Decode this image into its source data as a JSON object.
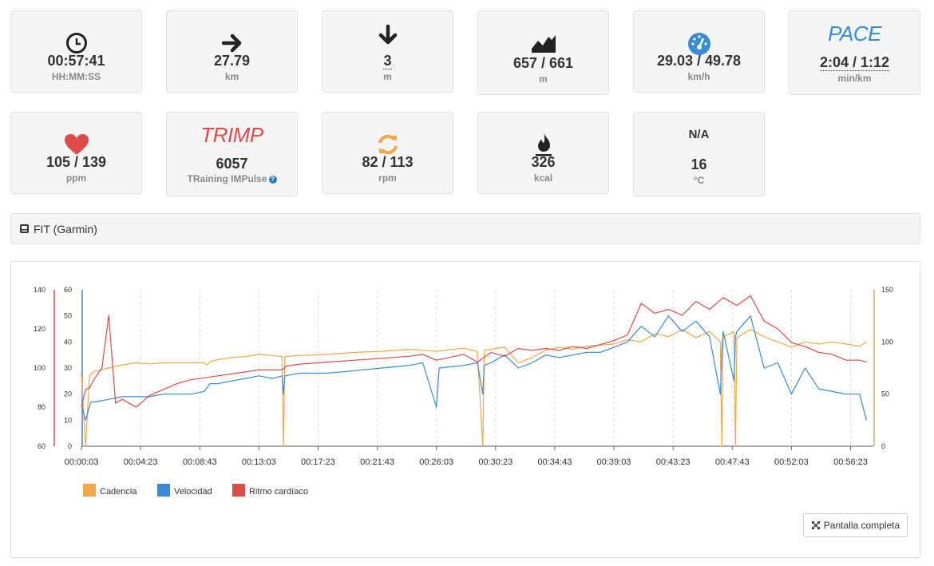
{
  "stats": {
    "time": {
      "value": "00:57:41",
      "unit": "HH:MM:SS"
    },
    "distance": {
      "value": "27.79",
      "unit": "km"
    },
    "descent": {
      "value": "3",
      "unit": "m"
    },
    "elevation": {
      "value": "657 / 661",
      "unit": "m"
    },
    "speed": {
      "value": "29.03 / 49.78",
      "unit": "km/h"
    },
    "pace": {
      "label": "PACE",
      "value": "2:04 / 1:12",
      "unit": "min/km"
    },
    "heart_rate": {
      "value": "105 / 139",
      "unit": "ppm"
    },
    "trimp": {
      "label": "TRIMP",
      "value": "6057",
      "unit": "TRaining IMPulse"
    },
    "cadence": {
      "value": "82 / 113",
      "unit": "rpm"
    },
    "calories": {
      "value": "326",
      "unit": "kcal"
    },
    "temperature": {
      "status": "N/A",
      "value": "16",
      "unit": "°C"
    }
  },
  "source": {
    "label": "FIT (Garmin)"
  },
  "fullscreen_label": "Pantalla completa",
  "colors": {
    "cadence": "#f0a848",
    "speed": "#3a8ad4",
    "heart_rate": "#df4b4b",
    "pace": "#3a8ad4",
    "trimp": "#df4b4b",
    "refresh": "#f0a848"
  },
  "chart_data": {
    "type": "line",
    "x_ticks": [
      "00:00:03",
      "00:04:23",
      "00:08:43",
      "00:13:03",
      "00:17:23",
      "00:21:43",
      "00:26:03",
      "00:30:23",
      "00:34:43",
      "00:39:03",
      "00:43:23",
      "00:47:43",
      "00:52:03",
      "00:56:23"
    ],
    "x_minutes": [
      0,
      58
    ],
    "legend": [
      "Cadencia",
      "Velocidad",
      "Ritmo cardíaco"
    ],
    "axes": {
      "heart_rate": {
        "ticks": [
          60,
          80,
          100,
          120,
          140
        ],
        "range": [
          60,
          140
        ]
      },
      "speed": {
        "ticks": [
          0,
          10,
          20,
          30,
          40,
          50,
          60
        ],
        "range": [
          0,
          60
        ]
      },
      "cadence": {
        "ticks": [
          0,
          50,
          100,
          150
        ],
        "range": [
          0,
          150
        ]
      }
    },
    "series": [
      {
        "name": "Cadencia",
        "axis": "cadence",
        "color": "#f0a848",
        "points": [
          [
            0,
            70
          ],
          [
            0.3,
            0
          ],
          [
            0.6,
            68
          ],
          [
            1,
            72
          ],
          [
            2,
            75
          ],
          [
            3,
            78
          ],
          [
            4,
            80
          ],
          [
            5,
            79
          ],
          [
            6,
            80
          ],
          [
            8,
            80
          ],
          [
            9,
            80
          ],
          [
            9.2,
            78
          ],
          [
            9.4,
            81
          ],
          [
            10,
            83
          ],
          [
            11,
            85
          ],
          [
            12,
            86
          ],
          [
            13,
            88
          ],
          [
            14,
            87
          ],
          [
            14.7,
            86
          ],
          [
            14.8,
            0
          ],
          [
            14.9,
            86
          ],
          [
            16,
            87
          ],
          [
            18,
            88
          ],
          [
            20,
            90
          ],
          [
            22,
            91
          ],
          [
            24,
            93
          ],
          [
            25,
            92
          ],
          [
            26,
            91
          ],
          [
            28,
            94
          ],
          [
            29,
            91
          ],
          [
            29.4,
            0
          ],
          [
            29.5,
            92
          ],
          [
            30,
            93
          ],
          [
            31,
            95
          ],
          [
            32,
            80
          ],
          [
            33,
            85
          ],
          [
            34,
            92
          ],
          [
            35,
            95
          ],
          [
            36,
            93
          ],
          [
            37,
            96
          ],
          [
            38,
            97
          ],
          [
            39,
            98
          ],
          [
            40,
            102
          ],
          [
            41,
            100
          ],
          [
            42,
            108
          ],
          [
            43,
            105
          ],
          [
            44,
            112
          ],
          [
            45,
            104
          ],
          [
            46,
            110
          ],
          [
            46.8,
            100
          ],
          [
            46.9,
            0
          ],
          [
            47,
            105
          ],
          [
            47.8,
            110
          ],
          [
            47.9,
            0
          ],
          [
            48,
            104
          ],
          [
            49,
            112
          ],
          [
            50,
            105
          ],
          [
            51,
            100
          ],
          [
            52,
            95
          ],
          [
            53,
            100
          ],
          [
            54,
            98
          ],
          [
            55,
            100
          ],
          [
            56,
            98
          ],
          [
            57,
            96
          ],
          [
            57.5,
            100
          ]
        ]
      },
      {
        "name": "Velocidad",
        "axis": "speed",
        "color": "#3a8ad4",
        "points": [
          [
            0,
            16
          ],
          [
            0.3,
            10
          ],
          [
            0.7,
            17
          ],
          [
            1,
            17
          ],
          [
            2,
            18
          ],
          [
            3,
            19
          ],
          [
            4,
            19
          ],
          [
            5,
            19
          ],
          [
            6,
            20
          ],
          [
            7,
            20
          ],
          [
            8,
            20
          ],
          [
            9,
            21
          ],
          [
            9.4,
            24
          ],
          [
            10,
            24
          ],
          [
            11,
            25
          ],
          [
            12,
            26
          ],
          [
            13,
            27
          ],
          [
            14,
            26
          ],
          [
            14.7,
            27
          ],
          [
            14.8,
            20
          ],
          [
            14.9,
            27
          ],
          [
            16,
            28
          ],
          [
            18,
            28
          ],
          [
            20,
            29
          ],
          [
            22,
            30
          ],
          [
            24,
            31
          ],
          [
            25,
            32
          ],
          [
            26,
            15
          ],
          [
            26.2,
            30
          ],
          [
            28,
            31
          ],
          [
            29,
            32
          ],
          [
            29.4,
            20
          ],
          [
            29.5,
            31
          ],
          [
            30,
            32
          ],
          [
            31,
            35
          ],
          [
            32,
            30
          ],
          [
            33,
            32
          ],
          [
            34,
            35
          ],
          [
            35,
            34
          ],
          [
            36,
            35
          ],
          [
            37,
            36
          ],
          [
            38,
            36
          ],
          [
            39,
            38
          ],
          [
            40,
            40
          ],
          [
            41,
            46
          ],
          [
            42,
            42
          ],
          [
            43,
            50
          ],
          [
            44,
            44
          ],
          [
            45,
            48
          ],
          [
            46,
            42
          ],
          [
            46.8,
            20
          ],
          [
            46.9,
            36
          ],
          [
            47,
            44
          ],
          [
            47.8,
            25
          ],
          [
            47.9,
            42
          ],
          [
            48,
            44
          ],
          [
            49,
            50
          ],
          [
            50,
            30
          ],
          [
            51,
            32
          ],
          [
            52,
            20
          ],
          [
            53,
            30
          ],
          [
            54,
            22
          ],
          [
            55,
            21
          ],
          [
            56,
            20
          ],
          [
            57,
            20
          ],
          [
            57.5,
            10
          ]
        ]
      },
      {
        "name": "Ritmo cardíaco",
        "axis": "heart_rate",
        "color": "#df4b4b",
        "points": [
          [
            0,
            80
          ],
          [
            0.3,
            89
          ],
          [
            0.6,
            90
          ],
          [
            1,
            95
          ],
          [
            1.5,
            100
          ],
          [
            2,
            127
          ],
          [
            2.5,
            82
          ],
          [
            3,
            84
          ],
          [
            4,
            80
          ],
          [
            5,
            86
          ],
          [
            6,
            89
          ],
          [
            7,
            92
          ],
          [
            8,
            94
          ],
          [
            9,
            95
          ],
          [
            10,
            96
          ],
          [
            11,
            97
          ],
          [
            12,
            98
          ],
          [
            13,
            99
          ],
          [
            14,
            99
          ],
          [
            14.7,
            99
          ],
          [
            15,
            101
          ],
          [
            16,
            102
          ],
          [
            18,
            103
          ],
          [
            20,
            104
          ],
          [
            22,
            105
          ],
          [
            24,
            106
          ],
          [
            25,
            107
          ],
          [
            26,
            104
          ],
          [
            28,
            107
          ],
          [
            29,
            103
          ],
          [
            30,
            108
          ],
          [
            31,
            106
          ],
          [
            32,
            110
          ],
          [
            33,
            109
          ],
          [
            34,
            110
          ],
          [
            35,
            109
          ],
          [
            36,
            111
          ],
          [
            37,
            110
          ],
          [
            38,
            112
          ],
          [
            39,
            114
          ],
          [
            40,
            117
          ],
          [
            41,
            133
          ],
          [
            42,
            128
          ],
          [
            43,
            130
          ],
          [
            44,
            127
          ],
          [
            45,
            134
          ],
          [
            46,
            130
          ],
          [
            47,
            136
          ],
          [
            48,
            132
          ],
          [
            49,
            137
          ],
          [
            50,
            124
          ],
          [
            51,
            120
          ],
          [
            52,
            113
          ],
          [
            53,
            111
          ],
          [
            54,
            108
          ],
          [
            55,
            107
          ],
          [
            56,
            104
          ],
          [
            57,
            104
          ],
          [
            57.5,
            103
          ]
        ]
      }
    ]
  }
}
